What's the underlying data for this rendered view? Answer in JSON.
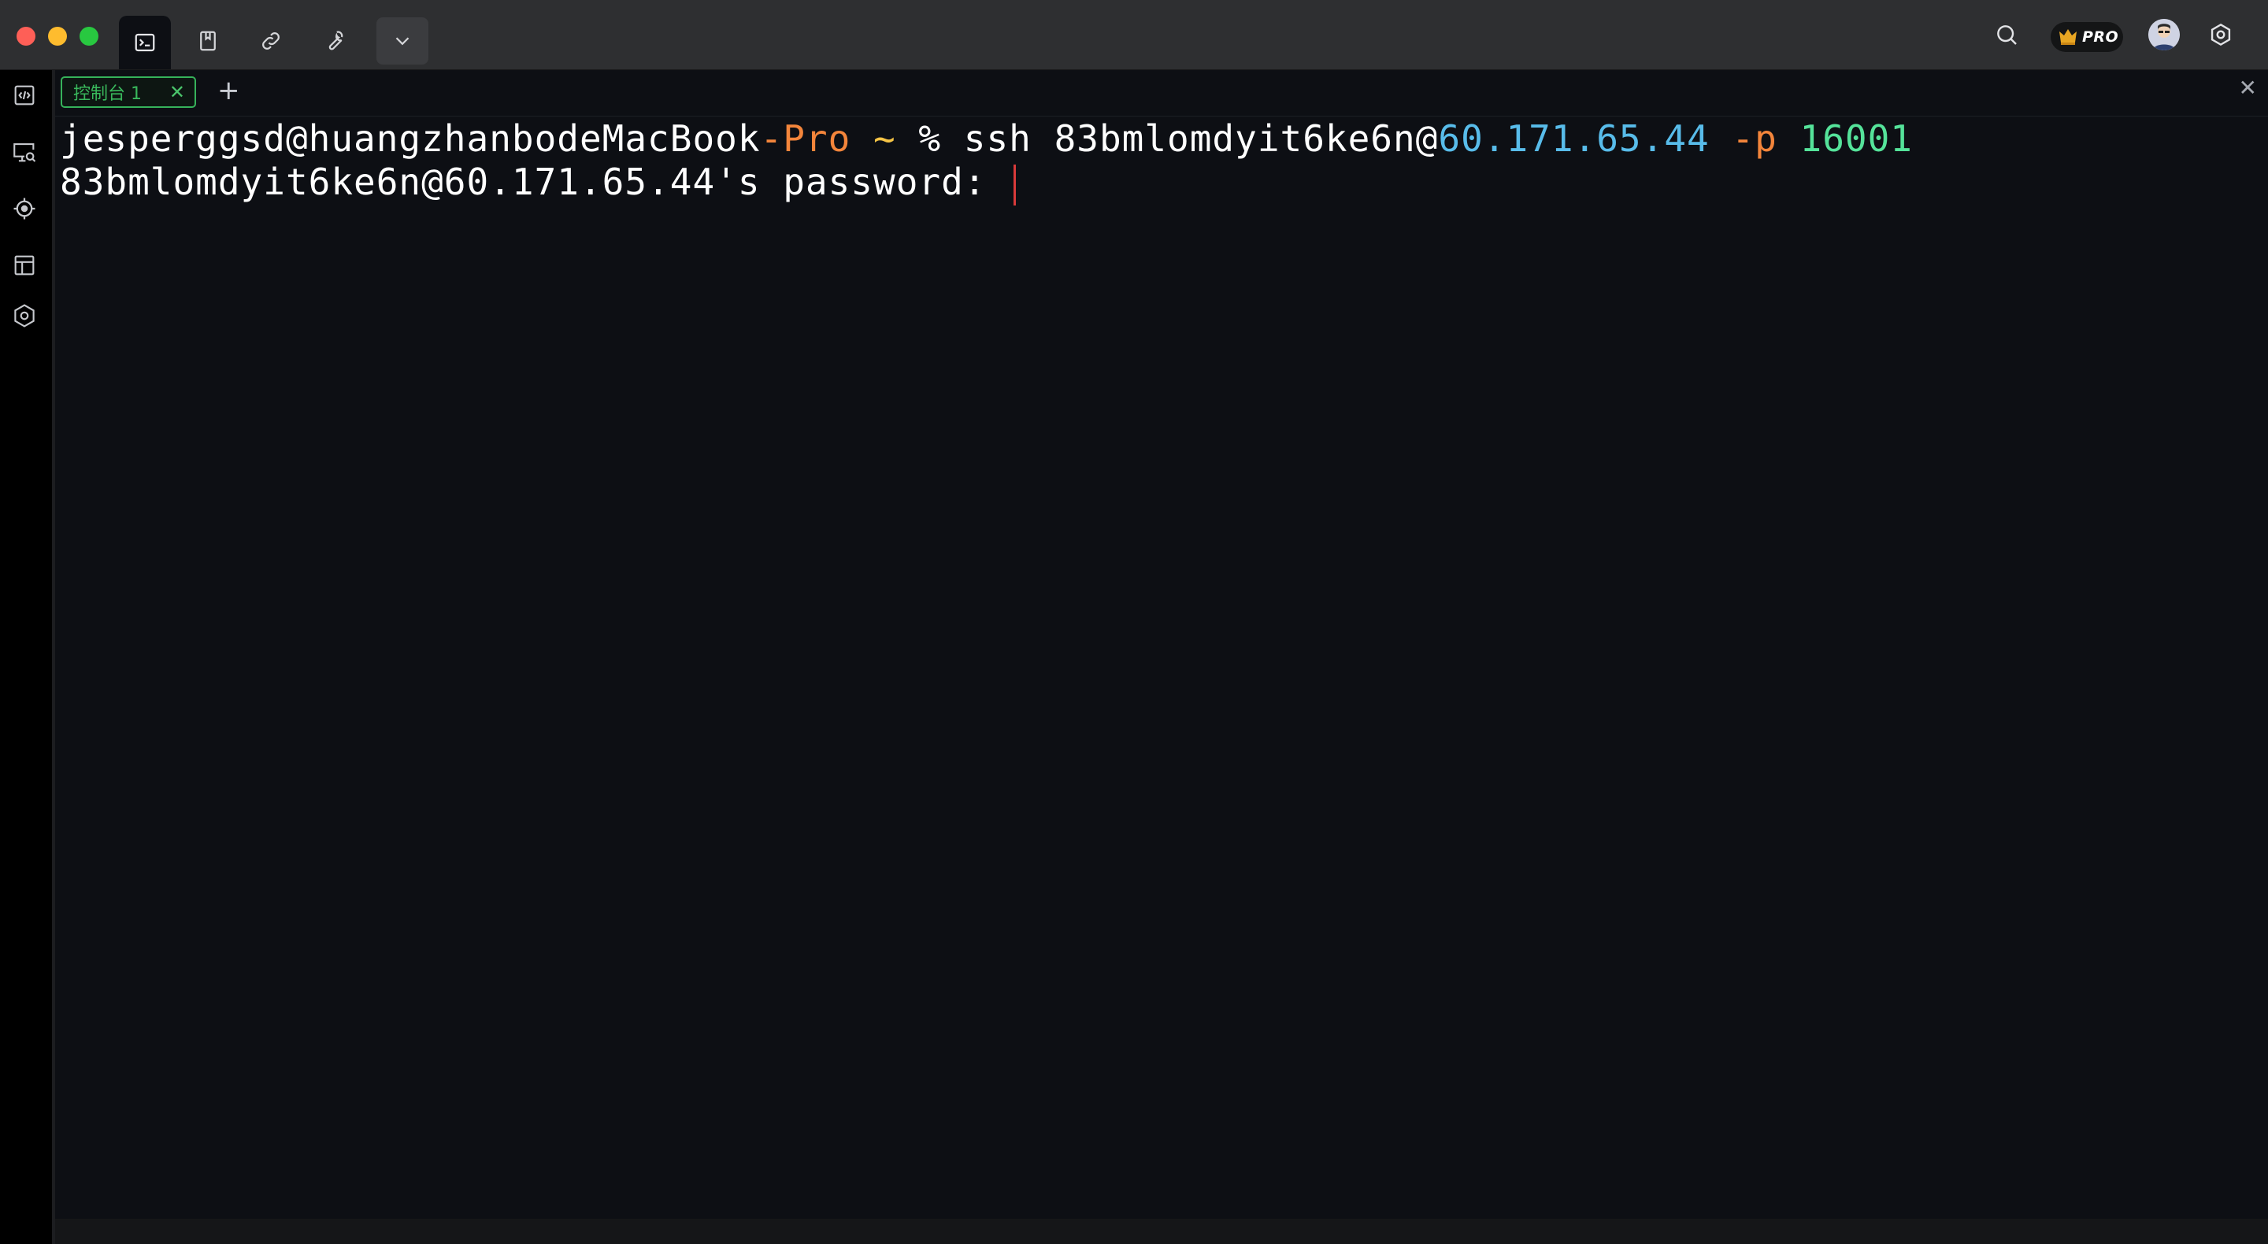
{
  "titlebar": {
    "tabs": [
      {
        "name": "terminal",
        "active": true
      },
      {
        "name": "bookmarks",
        "active": false
      },
      {
        "name": "links",
        "active": false
      },
      {
        "name": "tools",
        "active": false
      },
      {
        "name": "more-dropdown",
        "active": false
      }
    ],
    "pro_badge": "PRO"
  },
  "tabstrip": {
    "console_tab_label": "控制台  1",
    "console_tab_close": "✕",
    "add_tab": "+",
    "close_panel": "✕"
  },
  "terminal": {
    "line1": {
      "user_host": "jesperggsd@huangzhanbodeMacBook",
      "host_suffix": "-Pro",
      "tilde": " ~",
      "prompt": " % ssh 83bmlomdyit6ke6n@",
      "ip": "60.171.65.44",
      "flag": " -p",
      "port": " 16001"
    },
    "line2": "83bmlomdyit6ke6n@60.171.65.44's password: "
  },
  "colors": {
    "accent_green": "#39b85c",
    "orange": "#f3853b",
    "yellow": "#f5c446",
    "blue": "#58bcea",
    "green": "#55e39a",
    "cursor": "#d83a3a"
  }
}
